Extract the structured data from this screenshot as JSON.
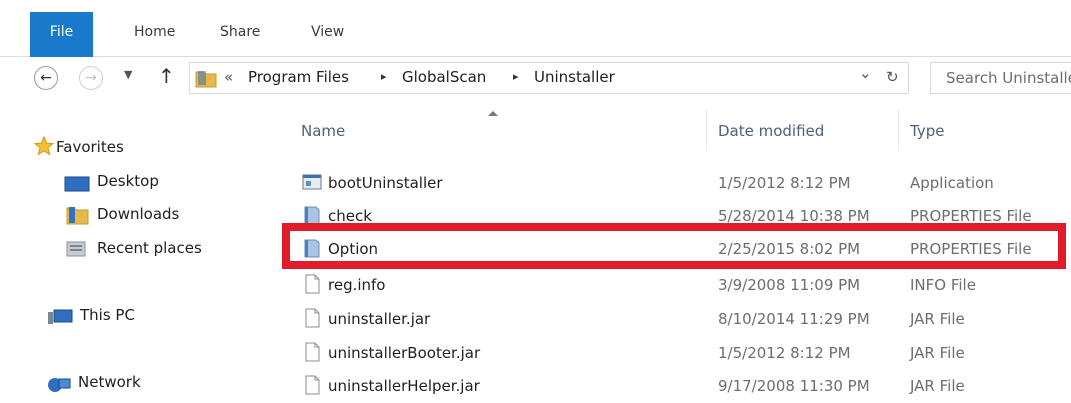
{
  "ribbon": {
    "tabs": [
      {
        "label": "File",
        "active": true
      },
      {
        "label": "Home"
      },
      {
        "label": "Share"
      },
      {
        "label": "View"
      }
    ]
  },
  "address": {
    "overflow_glyph": "«",
    "crumbs": [
      "Program Files",
      "GlobalScan",
      "Uninstaller"
    ],
    "separator_glyph": "▸",
    "dropdown_glyph": "⌄",
    "refresh_glyph": "↻"
  },
  "search": {
    "text": "Search Uninstaller"
  },
  "nav_pane": {
    "favorites": {
      "label": "Favorites",
      "items": [
        "Desktop",
        "Downloads",
        "Recent places"
      ]
    },
    "this_pc": "This PC",
    "network": "Network"
  },
  "columns": {
    "name": "Name",
    "date": "Date modified",
    "type": "Type"
  },
  "files": [
    {
      "name": "bootUninstaller",
      "date": "1/5/2012 8:12 PM",
      "type": "Application",
      "icon": "app-icon"
    },
    {
      "name": "check",
      "date": "5/28/2014 10:38 PM",
      "type": "PROPERTIES File",
      "icon": "properties-file-icon"
    },
    {
      "name": "Option",
      "date": "2/25/2015 8:02 PM",
      "type": "PROPERTIES File",
      "icon": "properties-file-icon",
      "highlighted": true
    },
    {
      "name": "reg.info",
      "date": "3/9/2008 11:09 PM",
      "type": "INFO File",
      "icon": "blank-file-icon"
    },
    {
      "name": "uninstaller.jar",
      "date": "8/10/2014 11:29 PM",
      "type": "JAR File",
      "icon": "blank-file-icon"
    },
    {
      "name": "uninstallerBooter.jar",
      "date": "1/5/2012 8:12 PM",
      "type": "JAR File",
      "icon": "blank-file-icon"
    },
    {
      "name": "uninstallerHelper.jar",
      "date": "9/17/2008 11:30 PM",
      "type": "JAR File",
      "icon": "blank-file-icon"
    }
  ],
  "colors": {
    "file_tab": "#1979ca",
    "highlight_box": "#e01c2a",
    "header_text": "#4c607a",
    "secondary_text": "#6d6d6d"
  }
}
